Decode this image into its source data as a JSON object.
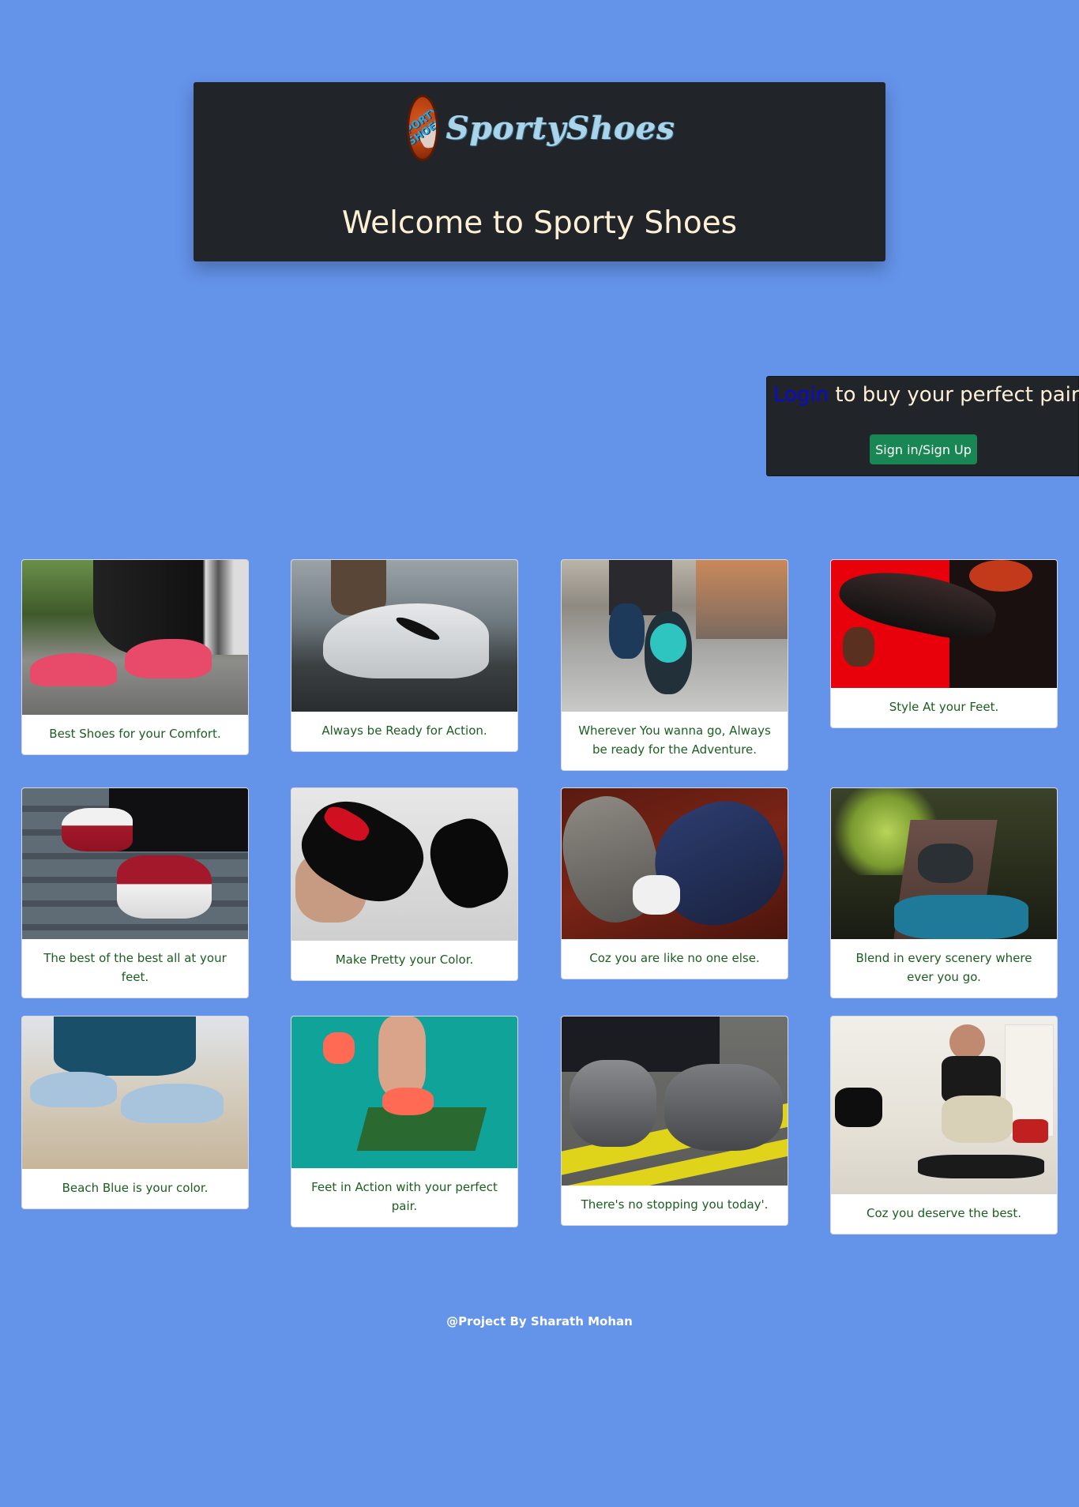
{
  "header": {
    "logo_badge_text": "SPORTY SHOES",
    "logo_text": "SportyShoes",
    "welcome": "Welcome to Sporty Shoes"
  },
  "login": {
    "link_text": "Login",
    "heading_rest": " to buy your perfect pair",
    "button_label": "Sign in/Sign Up"
  },
  "cards": [
    {
      "caption": "Best Shoes for your Comfort.",
      "image_desc": "pink sneakers lacing"
    },
    {
      "caption": "Always be Ready for Action.",
      "image_desc": "white nike sneaker"
    },
    {
      "caption": "Wherever You wanna go, Always be ready for the Adventure.",
      "image_desc": "walking city street"
    },
    {
      "caption": "Style At your Feet.",
      "image_desc": "black sneaker red background"
    },
    {
      "caption": "The best of the best all at your feet.",
      "image_desc": "red white high tops on stairs"
    },
    {
      "caption": "Make Pretty your Color.",
      "image_desc": "black patent loafers"
    },
    {
      "caption": "Coz you are like no one else.",
      "image_desc": "blue red laced sneakers"
    },
    {
      "caption": "Blend in every scenery where ever you go.",
      "image_desc": "sneakers on log in forest"
    },
    {
      "caption": "Beach Blue is your color.",
      "image_desc": "light blue running shoes on beach"
    },
    {
      "caption": "Feet in Action with your perfect pair.",
      "image_desc": "orange shoes on turf teal background"
    },
    {
      "caption": "There's no stopping you today'.",
      "image_desc": "grey knit sneakers on yellow line"
    },
    {
      "caption": "Coz you deserve the best.",
      "image_desc": "woman trying heels in store"
    }
  ],
  "footer": {
    "text": "@Project By Sharath Mohan"
  }
}
